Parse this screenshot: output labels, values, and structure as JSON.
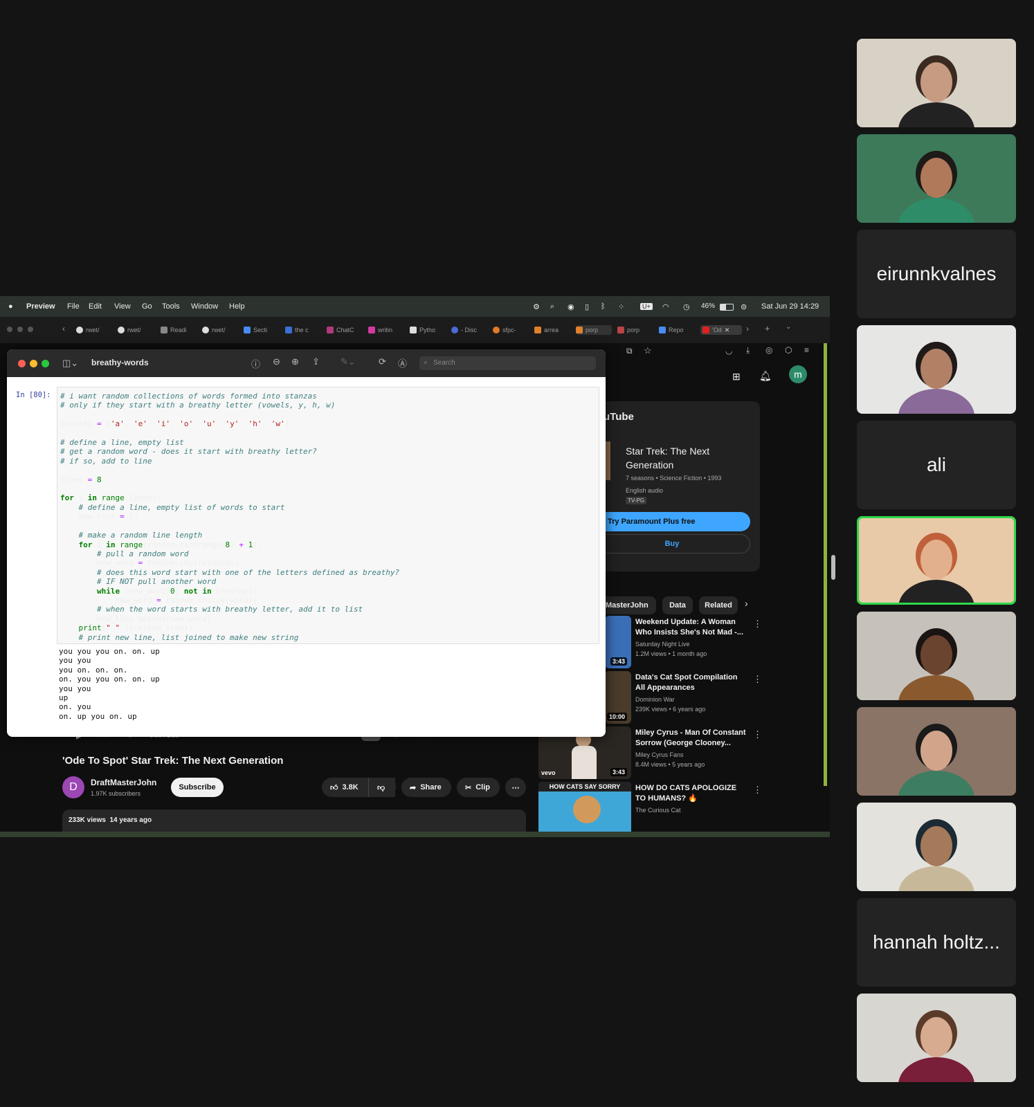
{
  "menubar": {
    "app": "Preview",
    "items": [
      "File",
      "Edit",
      "View",
      "Go",
      "Tools",
      "Window",
      "Help"
    ],
    "battery": "46%",
    "datetime": "Sat Jun 29  14:29"
  },
  "browser_tabs": [
    "rwet/",
    "rwet/",
    "Readi",
    "rwet/",
    "Secti",
    "the c",
    "ChatC",
    "writin",
    "Pytho",
    "- Disc",
    "sfpc-",
    "arrea",
    "porp",
    "porp",
    "Repo",
    "'Od"
  ],
  "preview": {
    "title": "breathy-words",
    "search_placeholder": "Search",
    "prompt": "In [80]:",
    "code_lines": [
      "# i want random collections of words formed into stanzas",
      "# only if they start with a breathy letter (vowels, y, h, w)",
      "",
      "breathy = ['a', 'e', 'i', 'o', 'u', 'y', 'h', 'w']",
      "",
      "# define a line, empty list",
      "# get a random word - does it start with breathy letter?",
      "# if so, add to line",
      "",
      "lines = 8",
      "",
      "for i in range(lines):",
      "    # define a line, empty list of words to start",
      "    new_line = []",
      "",
      "    # make a random line length",
      "    for i in range(random.randrange(8) + 1):",
      "        # pull a random word",
      "        new_word = random.choice(words)",
      "        # does this word start with one of the letters defined as breathy?",
      "        # IF NOT pull another word",
      "        while (new_word[0] not in breathy):",
      "            new_word = random.choice(words)",
      "        # when the word starts with breathy letter, add it to list",
      "        new_line.append(new_word)",
      "    print(\" \".join(new_line))",
      "    # print new line, list joined to make new string"
    ],
    "output_lines": [
      "you you you on. on. up",
      "you you",
      "you on. on. on.",
      "on. you you on. on. up",
      "you you",
      "up",
      "on. you",
      "on. up you on. up"
    ]
  },
  "youtube": {
    "avatar_letter": "m",
    "logo_partial": "uTube",
    "show": {
      "title": "Star Trek: The Next Generation",
      "meta": "7 seasons • Science Fiction • 1993",
      "audio": "English audio",
      "rating": "TV-PG",
      "cta": "Try Paramount Plus free",
      "buy": "Buy"
    },
    "chips": [
      "tMasterJohn",
      "Data",
      "Related"
    ],
    "player_time": "0:00 / 1:59",
    "video_title": "'Ode To Spot' Star Trek: The Next Generation",
    "channel": {
      "name": "DraftMasterJohn",
      "subs": "1.97K subscribers",
      "initial": "D"
    },
    "subscribe": "Subscribe",
    "likes": "3.8K",
    "share": "Share",
    "clip": "Clip",
    "views_line": "233K views  14 years ago",
    "recommended": [
      {
        "title": "Weekend Update: A Woman Who Insists She's Not Mad -...",
        "channel": "Saturday Night Live",
        "stats": "1.2M views • 1 month ago",
        "duration": "3:43",
        "color": "#3a6fb8"
      },
      {
        "title": "Data's Cat Spot Compilation All Appearances",
        "channel": "Dominion War",
        "stats": "239K views • 6 years ago",
        "duration": "10:00",
        "color": "#4a3b2a"
      },
      {
        "title": "Miley Cyrus - Man Of Constant Sorrow (George Clooney...",
        "channel": "Miley Cyrus Fans",
        "stats": "8.4M views • 5 years ago",
        "duration": "3:43",
        "color": "#2a2622",
        "badge": "vevo"
      },
      {
        "title": "HOW DO CATS APOLOGIZE TO HUMANS? 🔥",
        "channel": "The Curious Cat",
        "stats": "",
        "duration": "",
        "color": "#3fa6d8",
        "banner": "HOW CATS SAY SORRY"
      }
    ]
  },
  "participants": [
    {
      "name": "",
      "video": true,
      "bg": "#d8d2c6",
      "skin": "#c79a82",
      "hair": "#3a2a22",
      "shirt": "#222"
    },
    {
      "name": "",
      "video": true,
      "bg": "#3c7a5a",
      "skin": "#b07a5a",
      "hair": "#1e1a18",
      "shirt": "#2f8c68"
    },
    {
      "name": "eirunnkvalnes",
      "video": false
    },
    {
      "name": "",
      "video": true,
      "bg": "#e6e6e4",
      "skin": "#b28064",
      "hair": "#1f1a18",
      "shirt": "#8a6a98"
    },
    {
      "name": "ali",
      "video": false
    },
    {
      "name": "",
      "video": true,
      "bg": "#e8c9a8",
      "skin": "#e3b08e",
      "hair": "#c0603a",
      "shirt": "#222",
      "active": true
    },
    {
      "name": "",
      "video": true,
      "bg": "#c6c2bb",
      "skin": "#6b4430",
      "hair": "#1a1512",
      "shirt": "#8a5a2e"
    },
    {
      "name": "",
      "video": true,
      "bg": "#8a7466",
      "skin": "#d2a58a",
      "hair": "#1b1a1a",
      "shirt": "#3d7d62"
    },
    {
      "name": "",
      "video": true,
      "bg": "#e4e2dc",
      "skin": "#a47a5a",
      "hair": "#1c2a34",
      "shirt": "#c8b89a"
    },
    {
      "name": "hannah holtz...",
      "video": false
    },
    {
      "name": "",
      "video": true,
      "bg": "#d8d6d0",
      "skin": "#d7ab90",
      "hair": "#5a3b2a",
      "shirt": "#7a1f3a"
    }
  ]
}
